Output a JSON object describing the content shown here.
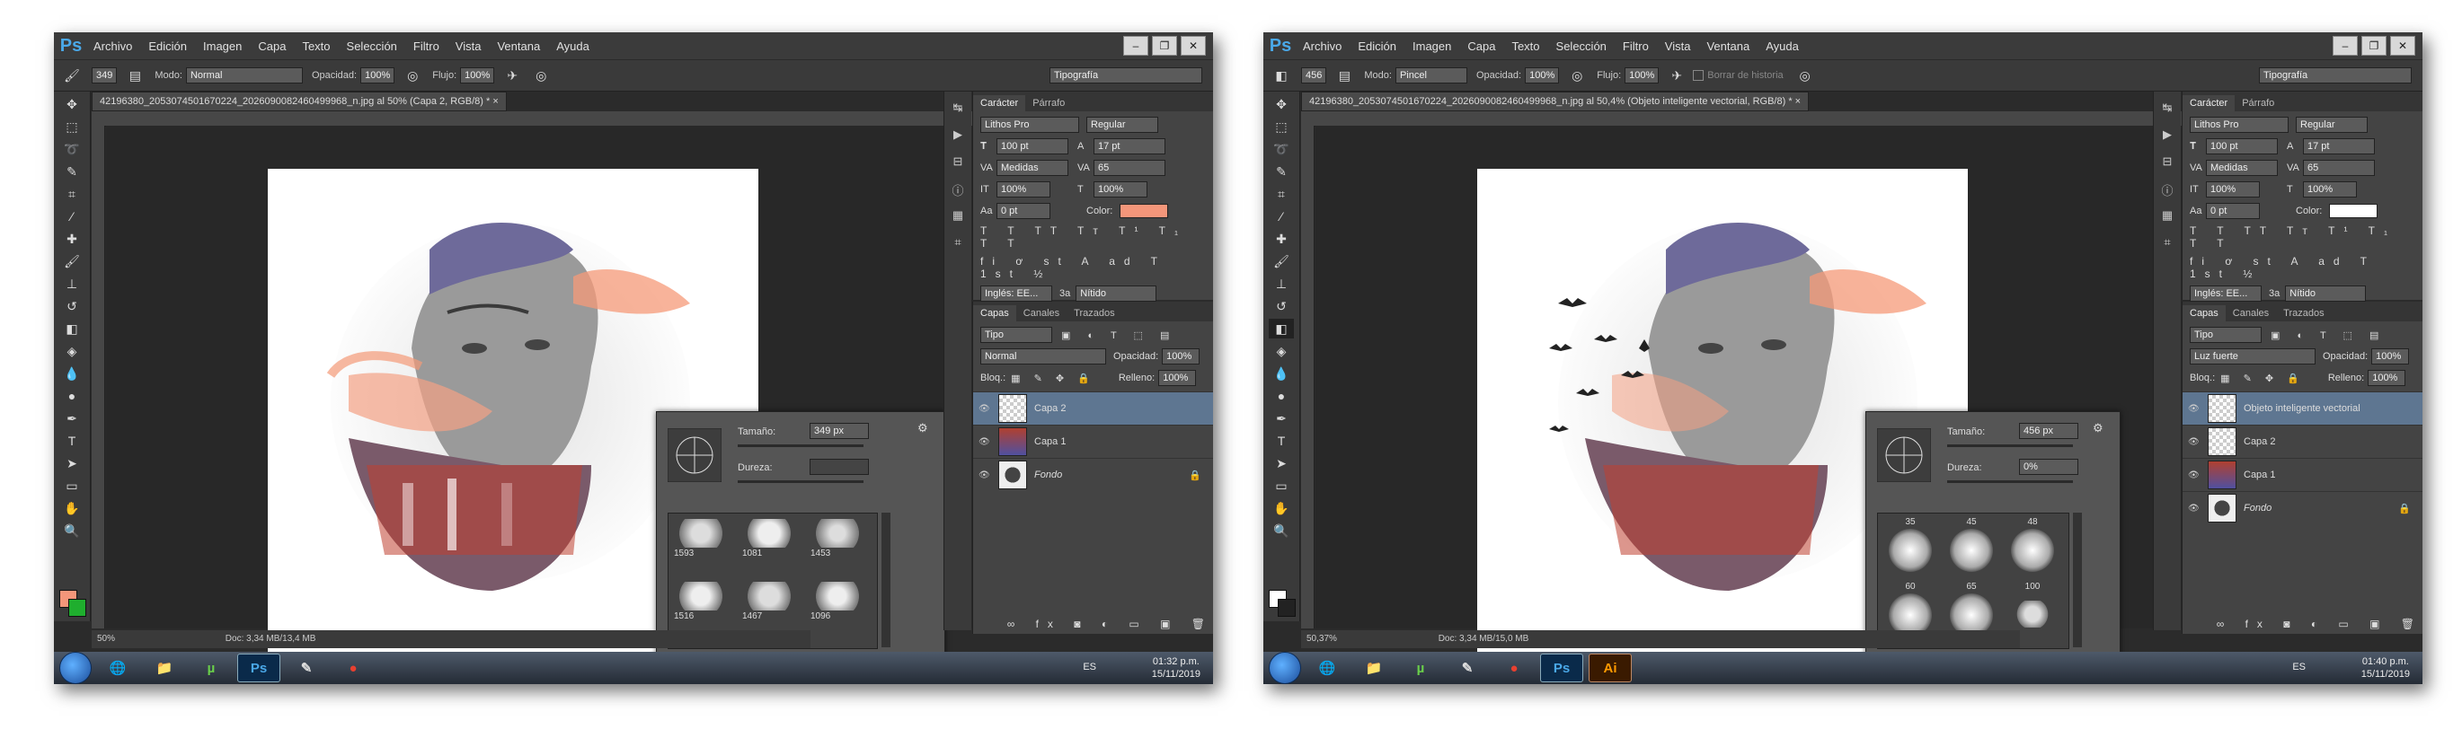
{
  "left": {
    "menu": [
      "Archivo",
      "Edición",
      "Imagen",
      "Capa",
      "Texto",
      "Selección",
      "Filtro",
      "Vista",
      "Ventana",
      "Ayuda"
    ],
    "options": {
      "size": "349",
      "mode_label": "Modo:",
      "mode": "Normal",
      "opacity_label": "Opacidad:",
      "opacity": "100%",
      "flow_label": "Flujo:",
      "flow": "100%",
      "workspace": "Tipografía"
    },
    "doc_tab": "42196380_2053074501670224_2026090082460499968_n.jpg al 50% (Capa 2, RGB/8) * ×",
    "zoom": "50%",
    "doc_info": "Doc: 3,34 MB/13,4 MB",
    "character": {
      "tab1": "Carácter",
      "tab2": "Párrafo",
      "font": "Lithos Pro",
      "style": "Regular",
      "size": "100 pt",
      "leading": "17 pt",
      "kerning": "Medidas",
      "tracking": "65",
      "vscale": "100%",
      "hscale": "100%",
      "baseline": "0 pt",
      "color_label": "Color:",
      "color": "#f4967a",
      "lang": "Inglés: EE...",
      "aa_label": "3a",
      "aa": "Nítido"
    },
    "layers": {
      "tabs": [
        "Capas",
        "Canales",
        "Trazados"
      ],
      "filter": "Tipo",
      "blend": "Normal",
      "opacity_label": "Opacidad:",
      "opacity": "100%",
      "lock_label": "Bloq.:",
      "fill_label": "Relleno:",
      "fill": "100%",
      "items": [
        {
          "name": "Capa 2",
          "selected": true
        },
        {
          "name": "Capa 1",
          "selected": false
        },
        {
          "name": "Fondo",
          "selected": false
        }
      ]
    },
    "brush": {
      "size_label": "Tamaño:",
      "size": "349 px",
      "hardness_label": "Dureza:",
      "hardness": "",
      "presets": [
        "1593",
        "1081",
        "1453",
        "1516",
        "1467",
        "1096"
      ]
    },
    "taskbar": {
      "lang": "ES",
      "time": "01:32 p.m.",
      "date": "15/11/2019",
      "apps": [
        "🌐",
        "📁",
        "µ",
        "Ps",
        "✎",
        "●"
      ]
    }
  },
  "right": {
    "menu": [
      "Archivo",
      "Edición",
      "Imagen",
      "Capa",
      "Texto",
      "Selección",
      "Filtro",
      "Vista",
      "Ventana",
      "Ayuda"
    ],
    "options": {
      "size": "456",
      "mode_label": "Modo:",
      "mode": "Pincel",
      "opacity_label": "Opacidad:",
      "opacity": "100%",
      "flow_label": "Flujo:",
      "flow": "100%",
      "history_label": "Borrar de historia",
      "workspace": "Tipografía"
    },
    "doc_tab": "42196380_2053074501670224_2026090082460499968_n.jpg al 50,4% (Objeto inteligente vectorial, RGB/8) * ×",
    "zoom": "50,37%",
    "doc_info": "Doc: 3,34 MB/15,0 MB",
    "character": {
      "tab1": "Carácter",
      "tab2": "Párrafo",
      "font": "Lithos Pro",
      "style": "Regular",
      "size": "100 pt",
      "leading": "17 pt",
      "kerning": "Medidas",
      "tracking": "65",
      "vscale": "100%",
      "hscale": "100%",
      "baseline": "0 pt",
      "color_label": "Color:",
      "color": "#ffffff",
      "lang": "Inglés: EE...",
      "aa_label": "3a",
      "aa": "Nítido"
    },
    "layers": {
      "tabs": [
        "Capas",
        "Canales",
        "Trazados"
      ],
      "filter": "Tipo",
      "blend": "Luz fuerte",
      "opacity_label": "Opacidad:",
      "opacity": "100%",
      "lock_label": "Bloq.:",
      "fill_label": "Relleno:",
      "fill": "100%",
      "items": [
        {
          "name": "Objeto inteligente vectorial",
          "selected": true
        },
        {
          "name": "Capa 2",
          "selected": false
        },
        {
          "name": "Capa 1",
          "selected": false
        },
        {
          "name": "Fondo",
          "selected": false
        }
      ]
    },
    "brush": {
      "size_label": "Tamaño:",
      "size": "456 px",
      "hardness_label": "Dureza:",
      "hardness": "0%",
      "presets": [
        "35",
        "45",
        "48",
        "60",
        "65",
        "100"
      ]
    },
    "taskbar": {
      "lang": "ES",
      "time": "01:40 p.m.",
      "date": "15/11/2019",
      "apps": [
        "🌐",
        "📁",
        "µ",
        "✎",
        "●",
        "Ps",
        "Ai"
      ]
    }
  }
}
